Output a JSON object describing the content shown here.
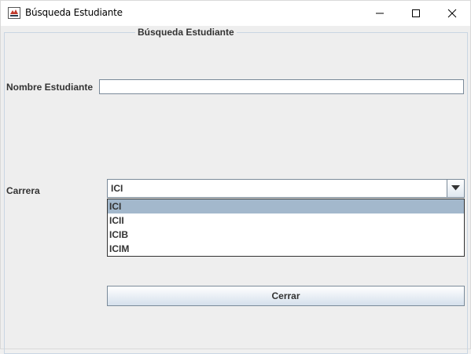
{
  "window": {
    "title": "Búsqueda Estudiante",
    "app_icon": "java-cup-icon",
    "controls": [
      "minimize-icon",
      "maximize-icon",
      "close-icon"
    ]
  },
  "form": {
    "group_title": "Búsqueda Estudiante",
    "nombre_label": "Nombre Estudiante",
    "nombre_value": "",
    "carrera_label": "Carrera",
    "carrera_selected": "ICI",
    "carrera_options": [
      "ICI",
      "ICII",
      "ICIB",
      "ICIM"
    ],
    "close_button_label": "Cerrar"
  },
  "colors": {
    "selection": "#a3b8cc",
    "panel_bg": "#eeeeee",
    "border": "#7a8a99"
  }
}
